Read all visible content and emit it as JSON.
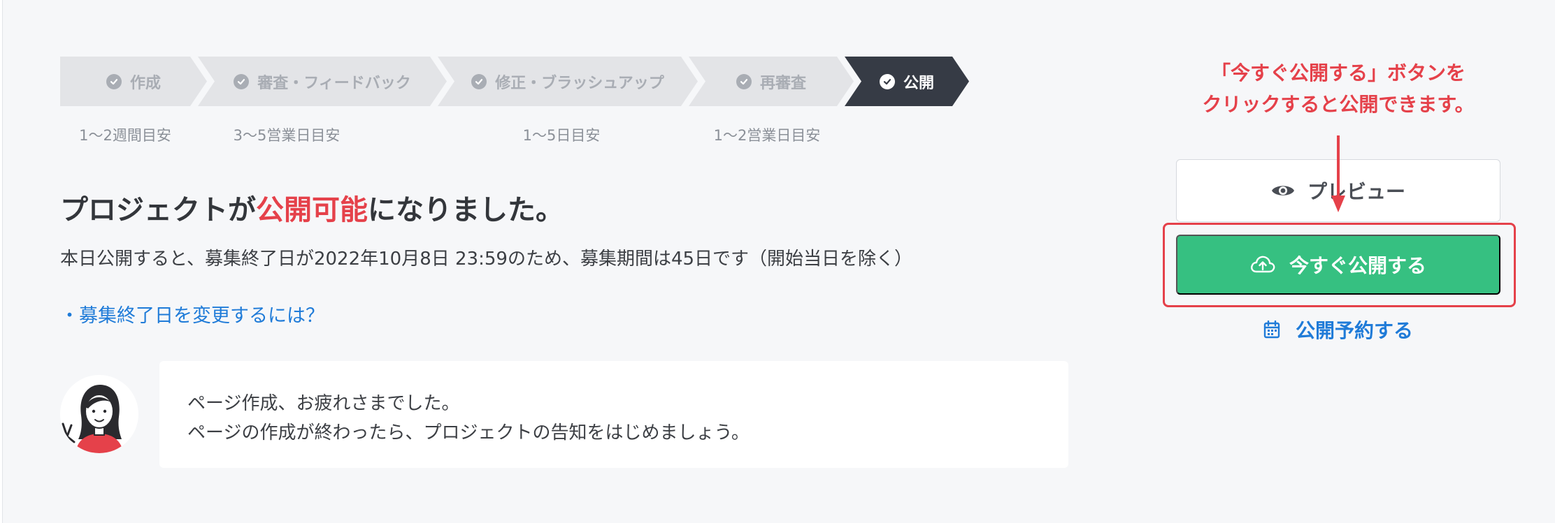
{
  "stepper": {
    "steps": [
      {
        "label": "作成",
        "duration": "1〜2週間目安"
      },
      {
        "label": "審査・フィードバック",
        "duration": "3〜5営業日目安"
      },
      {
        "label": "修正・ブラッシュアップ",
        "duration": "1〜5日目安"
      },
      {
        "label": "再審査",
        "duration": "1〜2営業日目安"
      },
      {
        "label": "公開",
        "duration": ""
      }
    ],
    "active_step": "公開"
  },
  "main": {
    "headline_before": "プロジェクトが",
    "headline_highlight": "公開可能",
    "headline_after": "になりました。",
    "info": "本日公開すると、募集終了日が2022年10月8日 23:59のため、募集期間は45日です（開始当日を除く）",
    "help_link": "・募集終了日を変更するには？"
  },
  "message": {
    "line1": "ページ作成、お疲れさまでした。",
    "line2": "ページの作成が終わったら、プロジェクトの告知をはじめましょう。"
  },
  "annotation": {
    "line1": "「今すぐ公開する」ボタンを",
    "line2": "クリックすると公開できます。"
  },
  "actions": {
    "preview_label": "プレビュー",
    "publish_label": "今すぐ公開する",
    "reserve_label": "公開予約する"
  },
  "icons": {
    "step_done": "check-circle-icon",
    "preview": "eye-icon",
    "publish": "cloud-upload-icon",
    "reserve": "calendar-icon",
    "avatar": "woman-avatar"
  },
  "colors": {
    "accent_red": "#e5414a",
    "publish_green": "#36c081",
    "link_blue": "#1f7bd8",
    "active_step": "#363b45"
  }
}
